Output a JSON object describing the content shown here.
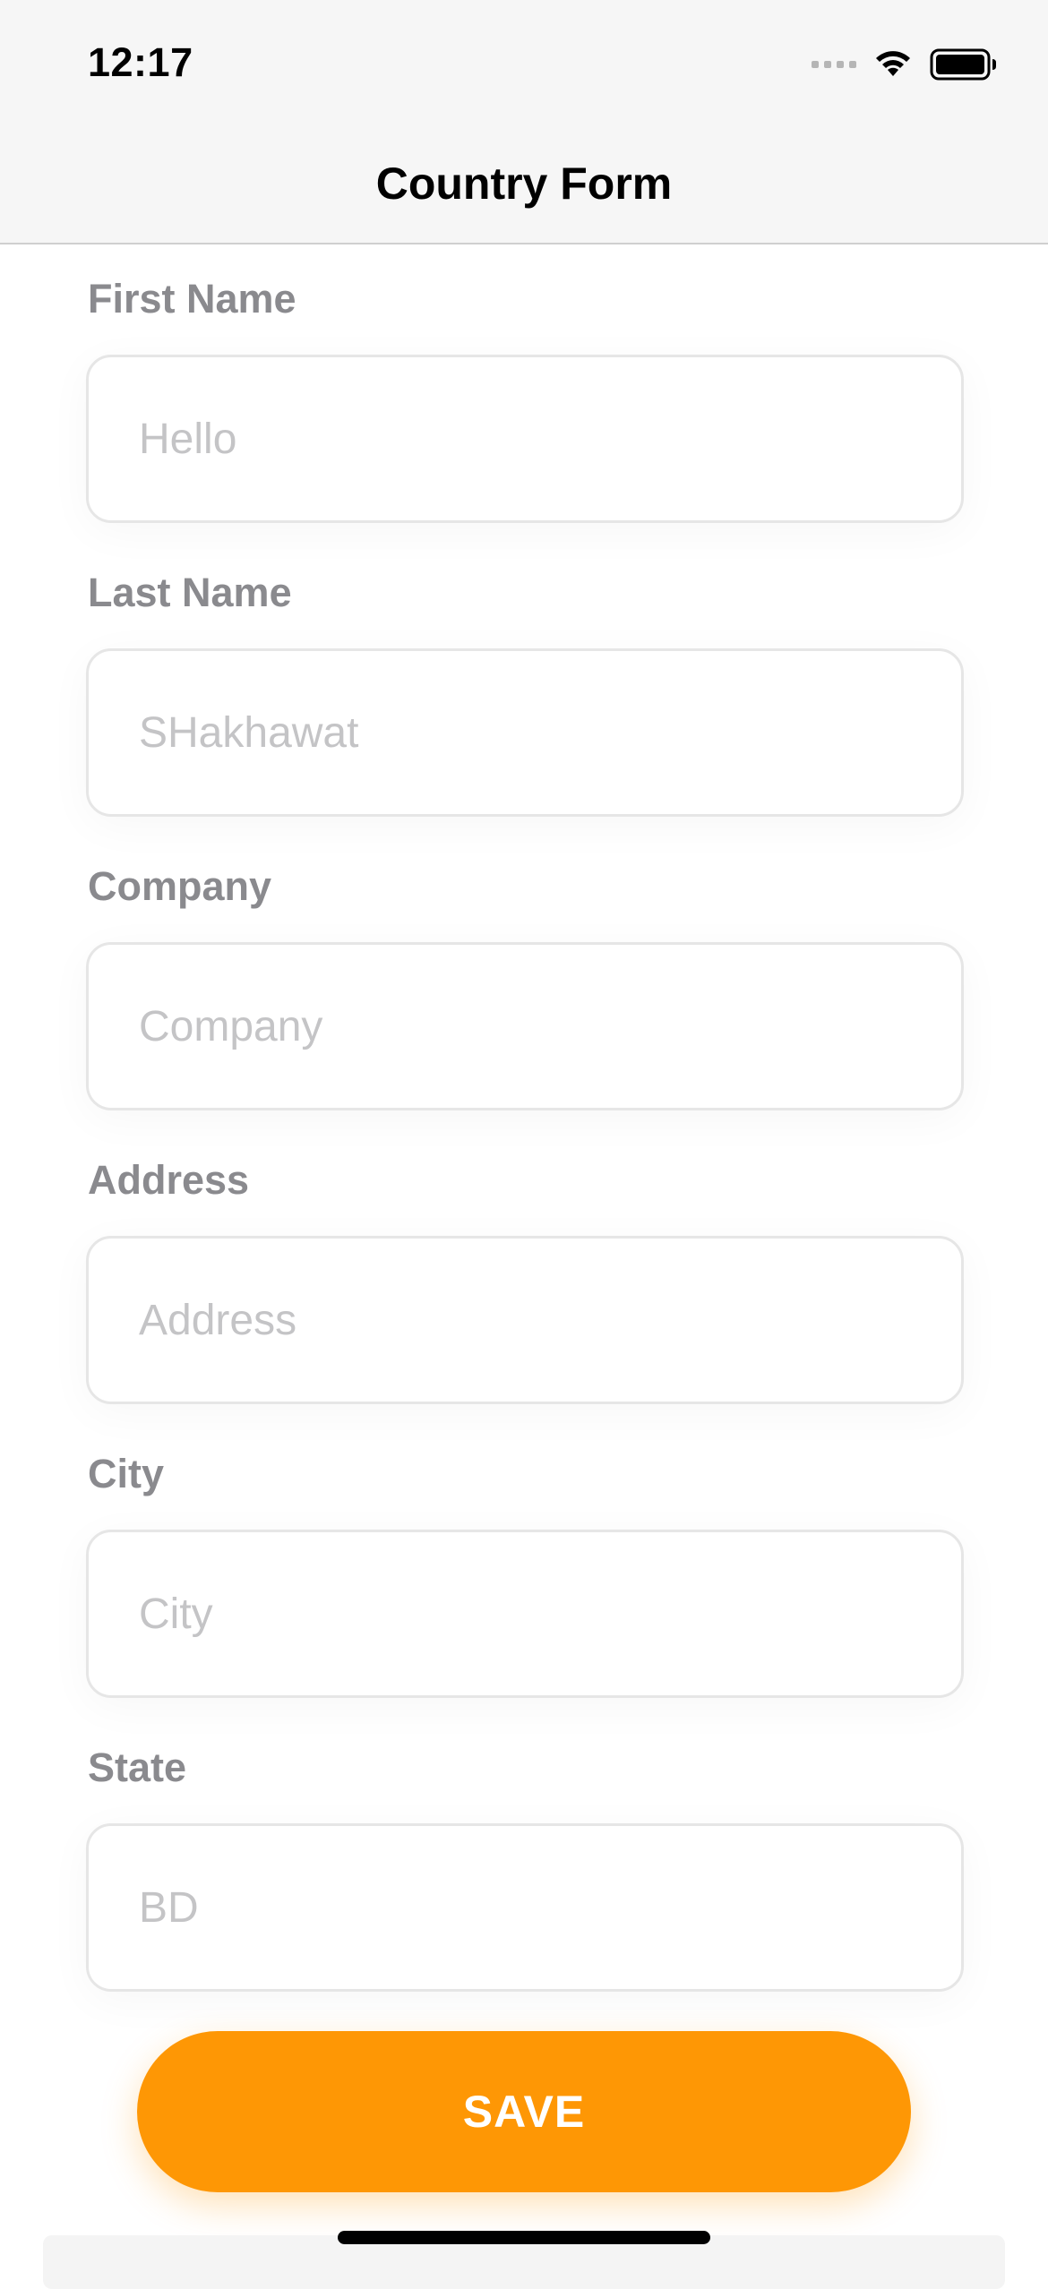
{
  "status_bar": {
    "time": "12:17"
  },
  "header": {
    "title": "Country Form"
  },
  "form": {
    "fields": [
      {
        "label": "First Name",
        "placeholder": "Hello",
        "value": ""
      },
      {
        "label": "Last Name",
        "placeholder": "SHakhawat",
        "value": ""
      },
      {
        "label": "Company",
        "placeholder": "Company",
        "value": ""
      },
      {
        "label": "Address",
        "placeholder": "Address",
        "value": ""
      },
      {
        "label": "City",
        "placeholder": "City",
        "value": ""
      },
      {
        "label": "State",
        "placeholder": "BD",
        "value": ""
      }
    ]
  },
  "actions": {
    "save_label": "SAVE"
  },
  "colors": {
    "accent": "#fe9705",
    "label": "#8a8a8e",
    "placeholder": "#c4c4c6",
    "input_border": "#e6e6e6",
    "header_bg": "#f6f6f6"
  },
  "icons": {
    "signal": "cellular-signal-icon",
    "wifi": "wifi-icon",
    "battery": "battery-icon"
  }
}
